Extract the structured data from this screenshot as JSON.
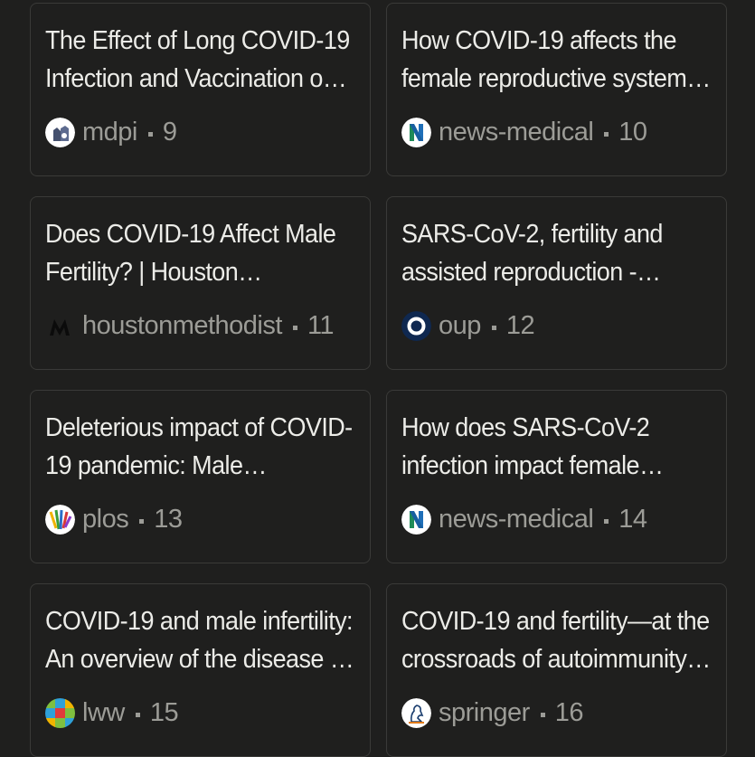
{
  "cards": [
    {
      "title": "The Effect of Long COVID-19 Infection and Vaccination o…",
      "source": "mdpi",
      "index": "9",
      "icon": "mdpi-icon"
    },
    {
      "title": "How COVID-19 affects the female reproductive system…",
      "source": "news-medical",
      "index": "10",
      "icon": "news-medical-icon"
    },
    {
      "title": "Does COVID-19 Affect Male Fertility? | Houston…",
      "source": "houstonmethodist",
      "index": "11",
      "icon": "houstonmethodist-icon"
    },
    {
      "title": "SARS-CoV-2, fertility and assisted reproduction -…",
      "source": "oup",
      "index": "12",
      "icon": "oup-icon"
    },
    {
      "title": "Deleterious impact of COVID-19 pandemic: Male…",
      "source": "plos",
      "index": "13",
      "icon": "plos-icon"
    },
    {
      "title": "How does SARS-CoV-2 infection impact female…",
      "source": "news-medical",
      "index": "14",
      "icon": "news-medical-icon"
    },
    {
      "title": "COVID-19 and male infertility: An overview of the disease …",
      "source": "lww",
      "index": "15",
      "icon": "lww-icon"
    },
    {
      "title": "COVID-19 and fertility—at the crossroads of autoimmunity…",
      "source": "springer",
      "index": "16",
      "icon": "springer-icon"
    }
  ],
  "colors": {
    "background": "#1f1f1e",
    "card_border": "#3a3a38",
    "title_text": "#ecece8",
    "meta_text": "#9c9c97"
  }
}
